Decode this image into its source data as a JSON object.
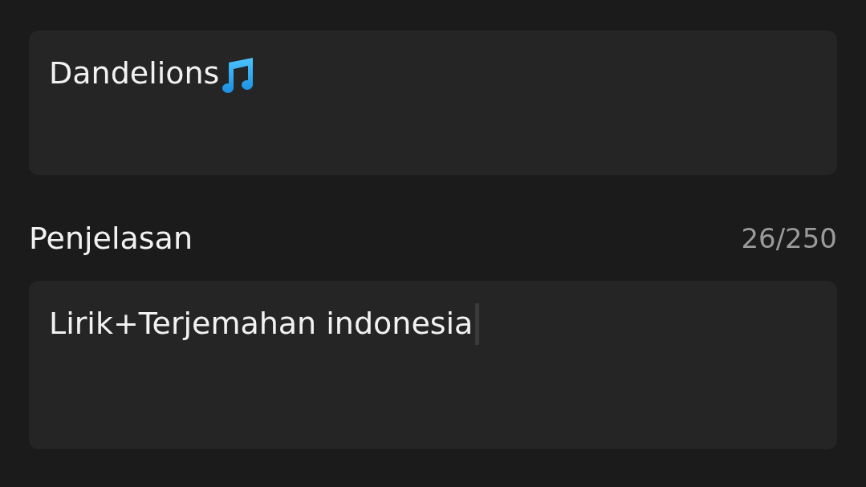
{
  "title_field": {
    "value": "Dandelions"
  },
  "description": {
    "label": "Penjelasan",
    "counter": "26/250",
    "value": "Lirik+Terjemahan indonesia",
    "focused": true
  }
}
